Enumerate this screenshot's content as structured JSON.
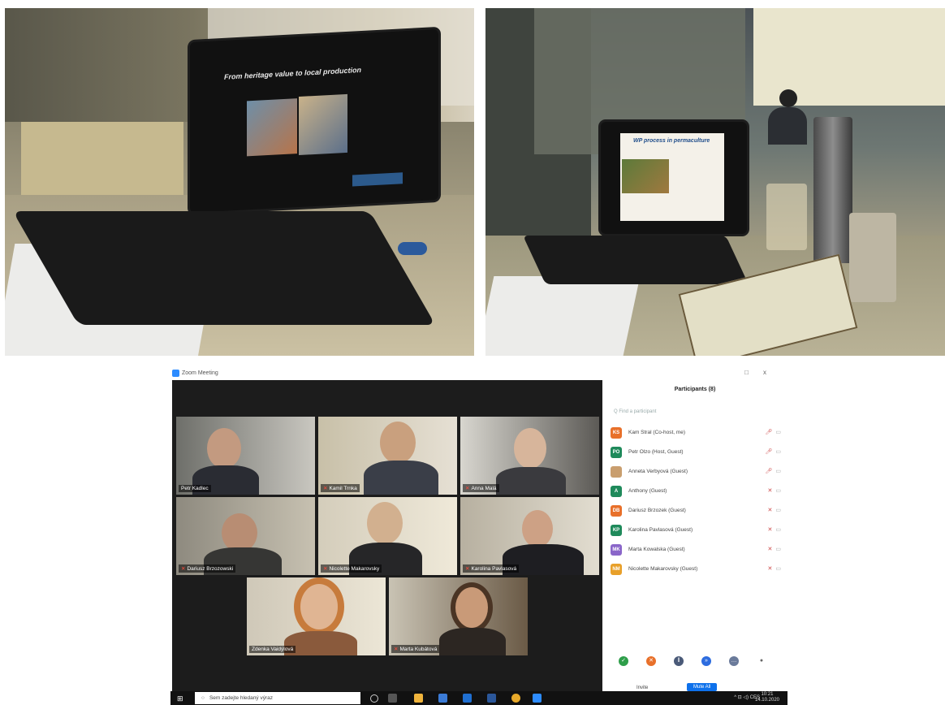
{
  "photo_left": {
    "slide_title": "From heritage value to local production"
  },
  "photo_right": {
    "slide_title": "WP process in permaculture"
  },
  "zoom": {
    "title": "Zoom Meeting",
    "window_controls": [
      "□",
      "x"
    ],
    "tiles": [
      {
        "name": "Petr Kadlec"
      },
      {
        "name": "Kamil Trnka"
      },
      {
        "name": "Anna Malá"
      },
      {
        "name": "Dariusz Brzozowski"
      },
      {
        "name": "Nicolette Makarovsky"
      },
      {
        "name": "Karolina Pavlasová"
      },
      {
        "name": "Zdenka Vaidýlová"
      },
      {
        "name": "Marta Kubátová"
      }
    ],
    "panel": {
      "title": "Participants (8)",
      "search_placeholder": "Q Find a participant",
      "participants": [
        {
          "initials": "KS",
          "name": "Kam Stral (Co-host, me)",
          "color": "#e8702a"
        },
        {
          "initials": "PO",
          "name": "Petr Olzo (Host, Guest)",
          "color": "#1f8a5b"
        },
        {
          "initials": "",
          "name": "Anneta Verbyová (Guest)",
          "color": "#c99e6e"
        },
        {
          "initials": "A",
          "name": "Anthony (Guest)",
          "color": "#1f8a5b"
        },
        {
          "initials": "DB",
          "name": "Dariusz Brzozek (Guest)",
          "color": "#e8702a"
        },
        {
          "initials": "KP",
          "name": "Karolina Pavlasová (Guest)",
          "color": "#1f8a5b"
        },
        {
          "initials": "MK",
          "name": "Marta Kowalska (Guest)",
          "color": "#8a66c9"
        },
        {
          "initials": "NM",
          "name": "Nicolette Makarovsky (Guest)",
          "color": "#e8a02a"
        }
      ],
      "reactions": [
        "✓",
        "✕",
        "‖",
        "»",
        "…",
        "●"
      ],
      "invite_label": "Invite",
      "mute_all_label": "Mute All"
    }
  },
  "taskbar": {
    "start_icon": "⊞",
    "search_text": "Sem zadejte hledaný výraz",
    "tray_text": "^ ⊡ ◁) CES",
    "time": "10:21",
    "date": "14.10.2020"
  },
  "colors": {
    "zoom_blue": "#2d8cff",
    "active_speaker": "#d8c33a",
    "muted_red": "#ff4a3a"
  }
}
